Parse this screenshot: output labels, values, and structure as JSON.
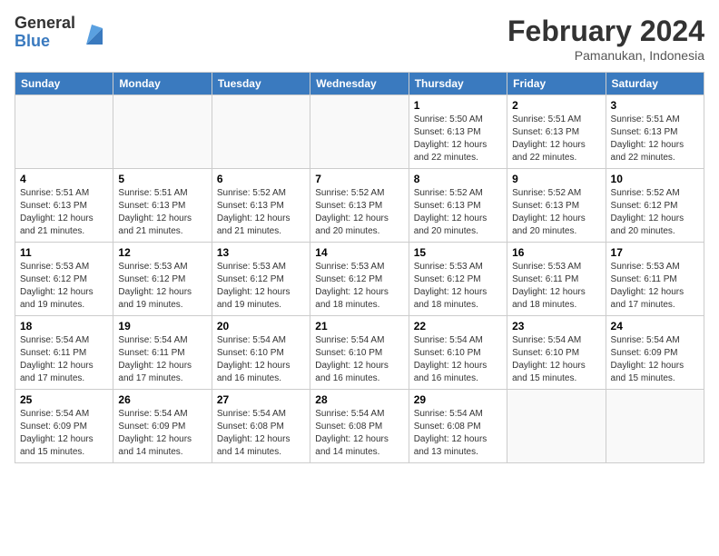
{
  "logo": {
    "general": "General",
    "blue": "Blue"
  },
  "title": "February 2024",
  "subtitle": "Pamanukan, Indonesia",
  "days_header": [
    "Sunday",
    "Monday",
    "Tuesday",
    "Wednesday",
    "Thursday",
    "Friday",
    "Saturday"
  ],
  "weeks": [
    [
      {
        "num": "",
        "info": ""
      },
      {
        "num": "",
        "info": ""
      },
      {
        "num": "",
        "info": ""
      },
      {
        "num": "",
        "info": ""
      },
      {
        "num": "1",
        "info": "Sunrise: 5:50 AM\nSunset: 6:13 PM\nDaylight: 12 hours\nand 22 minutes."
      },
      {
        "num": "2",
        "info": "Sunrise: 5:51 AM\nSunset: 6:13 PM\nDaylight: 12 hours\nand 22 minutes."
      },
      {
        "num": "3",
        "info": "Sunrise: 5:51 AM\nSunset: 6:13 PM\nDaylight: 12 hours\nand 22 minutes."
      }
    ],
    [
      {
        "num": "4",
        "info": "Sunrise: 5:51 AM\nSunset: 6:13 PM\nDaylight: 12 hours\nand 21 minutes."
      },
      {
        "num": "5",
        "info": "Sunrise: 5:51 AM\nSunset: 6:13 PM\nDaylight: 12 hours\nand 21 minutes."
      },
      {
        "num": "6",
        "info": "Sunrise: 5:52 AM\nSunset: 6:13 PM\nDaylight: 12 hours\nand 21 minutes."
      },
      {
        "num": "7",
        "info": "Sunrise: 5:52 AM\nSunset: 6:13 PM\nDaylight: 12 hours\nand 20 minutes."
      },
      {
        "num": "8",
        "info": "Sunrise: 5:52 AM\nSunset: 6:13 PM\nDaylight: 12 hours\nand 20 minutes."
      },
      {
        "num": "9",
        "info": "Sunrise: 5:52 AM\nSunset: 6:13 PM\nDaylight: 12 hours\nand 20 minutes."
      },
      {
        "num": "10",
        "info": "Sunrise: 5:52 AM\nSunset: 6:12 PM\nDaylight: 12 hours\nand 20 minutes."
      }
    ],
    [
      {
        "num": "11",
        "info": "Sunrise: 5:53 AM\nSunset: 6:12 PM\nDaylight: 12 hours\nand 19 minutes."
      },
      {
        "num": "12",
        "info": "Sunrise: 5:53 AM\nSunset: 6:12 PM\nDaylight: 12 hours\nand 19 minutes."
      },
      {
        "num": "13",
        "info": "Sunrise: 5:53 AM\nSunset: 6:12 PM\nDaylight: 12 hours\nand 19 minutes."
      },
      {
        "num": "14",
        "info": "Sunrise: 5:53 AM\nSunset: 6:12 PM\nDaylight: 12 hours\nand 18 minutes."
      },
      {
        "num": "15",
        "info": "Sunrise: 5:53 AM\nSunset: 6:12 PM\nDaylight: 12 hours\nand 18 minutes."
      },
      {
        "num": "16",
        "info": "Sunrise: 5:53 AM\nSunset: 6:11 PM\nDaylight: 12 hours\nand 18 minutes."
      },
      {
        "num": "17",
        "info": "Sunrise: 5:53 AM\nSunset: 6:11 PM\nDaylight: 12 hours\nand 17 minutes."
      }
    ],
    [
      {
        "num": "18",
        "info": "Sunrise: 5:54 AM\nSunset: 6:11 PM\nDaylight: 12 hours\nand 17 minutes."
      },
      {
        "num": "19",
        "info": "Sunrise: 5:54 AM\nSunset: 6:11 PM\nDaylight: 12 hours\nand 17 minutes."
      },
      {
        "num": "20",
        "info": "Sunrise: 5:54 AM\nSunset: 6:10 PM\nDaylight: 12 hours\nand 16 minutes."
      },
      {
        "num": "21",
        "info": "Sunrise: 5:54 AM\nSunset: 6:10 PM\nDaylight: 12 hours\nand 16 minutes."
      },
      {
        "num": "22",
        "info": "Sunrise: 5:54 AM\nSunset: 6:10 PM\nDaylight: 12 hours\nand 16 minutes."
      },
      {
        "num": "23",
        "info": "Sunrise: 5:54 AM\nSunset: 6:10 PM\nDaylight: 12 hours\nand 15 minutes."
      },
      {
        "num": "24",
        "info": "Sunrise: 5:54 AM\nSunset: 6:09 PM\nDaylight: 12 hours\nand 15 minutes."
      }
    ],
    [
      {
        "num": "25",
        "info": "Sunrise: 5:54 AM\nSunset: 6:09 PM\nDaylight: 12 hours\nand 15 minutes."
      },
      {
        "num": "26",
        "info": "Sunrise: 5:54 AM\nSunset: 6:09 PM\nDaylight: 12 hours\nand 14 minutes."
      },
      {
        "num": "27",
        "info": "Sunrise: 5:54 AM\nSunset: 6:08 PM\nDaylight: 12 hours\nand 14 minutes."
      },
      {
        "num": "28",
        "info": "Sunrise: 5:54 AM\nSunset: 6:08 PM\nDaylight: 12 hours\nand 14 minutes."
      },
      {
        "num": "29",
        "info": "Sunrise: 5:54 AM\nSunset: 6:08 PM\nDaylight: 12 hours\nand 13 minutes."
      },
      {
        "num": "",
        "info": ""
      },
      {
        "num": "",
        "info": ""
      }
    ]
  ]
}
